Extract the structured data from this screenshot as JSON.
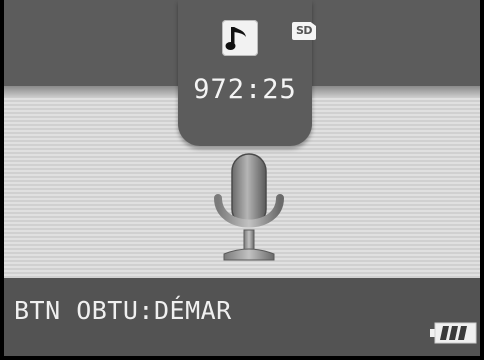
{
  "screen": {
    "recording_time": "972:25",
    "shutter_hint": "BTN OBTU:DÉMAR",
    "storage_label": "SD"
  },
  "icons": {
    "mode": "music-note-icon",
    "storage": "sd-card-icon",
    "subject": "microphone-icon",
    "battery": "battery-icon"
  },
  "colors": {
    "panel_dark": "#5c5c5c",
    "panel_light": "#d8d8d8",
    "bottom_bar": "#535353",
    "text": "#f4f4f4"
  }
}
